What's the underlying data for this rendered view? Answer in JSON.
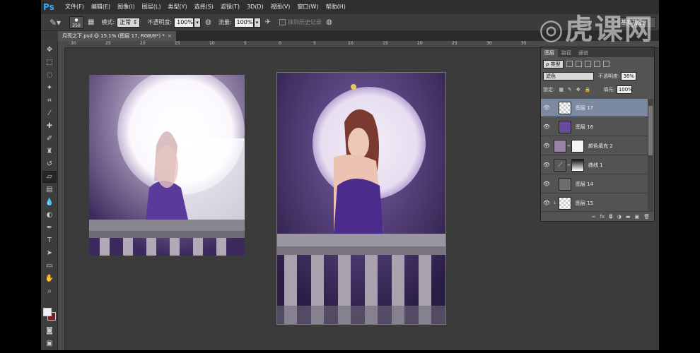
{
  "app": {
    "logo": "Ps",
    "menu": [
      "文件(F)",
      "编辑(E)",
      "图像(I)",
      "图层(L)",
      "类型(Y)",
      "选择(S)",
      "滤镜(T)",
      "3D(D)",
      "视图(V)",
      "窗口(W)",
      "帮助(H)"
    ]
  },
  "options": {
    "brush_size": "250",
    "mode_label": "模式:",
    "mode_value": "正常",
    "opacity_label": "不透明度:",
    "opacity_value": "100%",
    "flow_label": "流量:",
    "flow_value": "100%",
    "erase_history_label": "抹到历史记录",
    "workspace": "基本功能"
  },
  "document_tab": {
    "title": "月亮之下.psd @ 15.1% (图层 17, RGB/8*) *",
    "close": "×"
  },
  "ruler": {
    "labels": [
      "30",
      "25",
      "20",
      "15",
      "10",
      "5",
      "0",
      "5",
      "10",
      "15",
      "20",
      "25",
      "30",
      "35"
    ]
  },
  "layers_panel": {
    "tabs": [
      "图层",
      "路径",
      "通道"
    ],
    "filter_kind": "ρ 类型",
    "blend_mode": "滤色",
    "opacity_label": "不透明度:",
    "opacity_value": "36%",
    "lock_label": "锁定:",
    "fill_label": "填充:",
    "fill_value": "100%",
    "layers": [
      {
        "name": "图层 17",
        "selected": true
      },
      {
        "name": "图层 16",
        "selected": false
      },
      {
        "name": "颜色填充 2",
        "selected": false
      },
      {
        "name": "曲线 1",
        "selected": false
      },
      {
        "name": "图层 14",
        "selected": false
      },
      {
        "name": "图层 15",
        "selected": false
      }
    ],
    "footer_icons": [
      "link-icon",
      "fx-icon",
      "mask-icon",
      "adjustment-icon",
      "folder-icon",
      "new-layer-icon",
      "trash-icon"
    ]
  },
  "watermark": {
    "text": "虎课网"
  },
  "colors": {
    "foreground": "#f2eef6",
    "background": "#7b1f25",
    "selected_layer": "#7b8aa0"
  }
}
